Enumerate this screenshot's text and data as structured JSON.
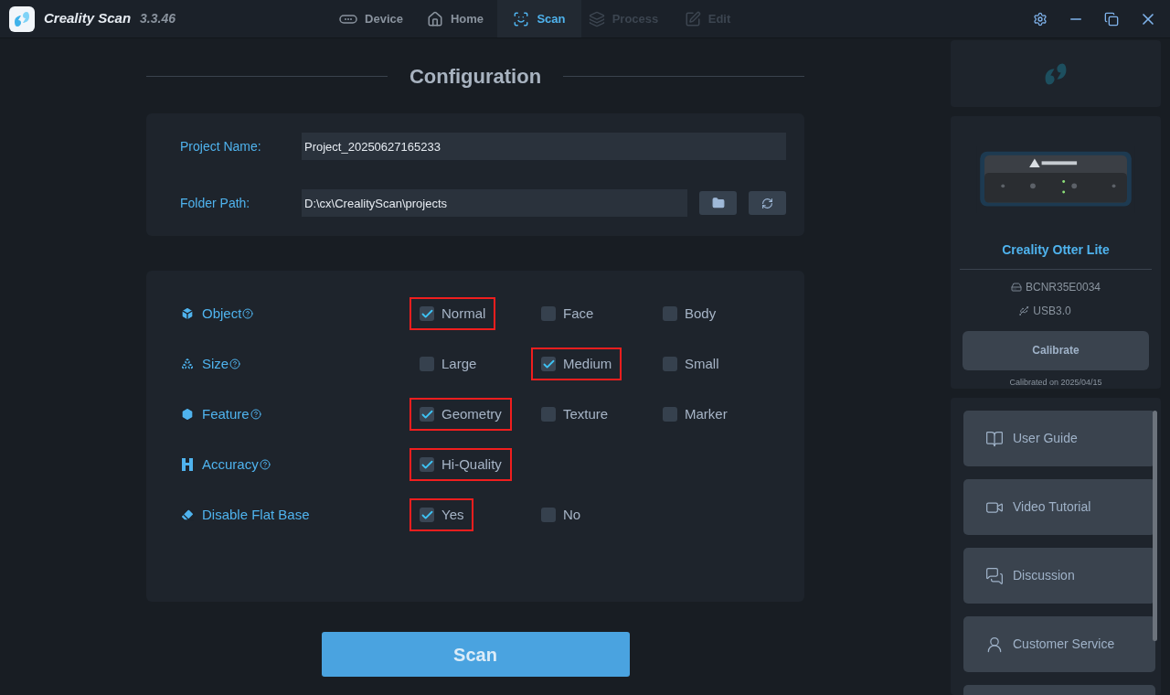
{
  "app": {
    "name": "Creality Scan",
    "version": "3.3.46"
  },
  "tabs": [
    {
      "label": "Device",
      "selected": false,
      "disabled": false
    },
    {
      "label": "Home",
      "selected": false,
      "disabled": false
    },
    {
      "label": "Scan",
      "selected": true,
      "disabled": false
    },
    {
      "label": "Process",
      "selected": false,
      "disabled": true
    },
    {
      "label": "Edit",
      "selected": false,
      "disabled": true
    }
  ],
  "heading": "Configuration",
  "project": {
    "name_label": "Project Name:",
    "name_value": "Project_20250627165233",
    "folder_label": "Folder Path:",
    "folder_value": "D:\\cx\\CrealityScan\\projects"
  },
  "settings": [
    {
      "label": "Object",
      "help": true,
      "options": [
        {
          "label": "Normal",
          "checked": true,
          "highlighted": true
        },
        {
          "label": "Face",
          "checked": false,
          "highlighted": false
        },
        {
          "label": "Body",
          "checked": false,
          "highlighted": false
        }
      ]
    },
    {
      "label": "Size",
      "help": true,
      "options": [
        {
          "label": "Large",
          "checked": false,
          "highlighted": false
        },
        {
          "label": "Medium",
          "checked": true,
          "highlighted": true
        },
        {
          "label": "Small",
          "checked": false,
          "highlighted": false
        }
      ]
    },
    {
      "label": "Feature",
      "help": true,
      "options": [
        {
          "label": "Geometry",
          "checked": true,
          "highlighted": true
        },
        {
          "label": "Texture",
          "checked": false,
          "highlighted": false
        },
        {
          "label": "Marker",
          "checked": false,
          "highlighted": false
        }
      ]
    },
    {
      "label": "Accuracy",
      "help": true,
      "options": [
        {
          "label": "Hi-Quality",
          "checked": true,
          "highlighted": true
        }
      ]
    },
    {
      "label": "Disable Flat Base",
      "help": false,
      "options": [
        {
          "label": "Yes",
          "checked": true,
          "highlighted": true
        },
        {
          "label": "No",
          "checked": false,
          "highlighted": false
        }
      ]
    }
  ],
  "scan_button": "Scan",
  "device": {
    "name": "Creality Otter Lite",
    "serial": "BCNR35E0034",
    "connection": "USB3.0",
    "calibrate": "Calibrate",
    "calibrated_on": "Calibrated on 2025/04/15"
  },
  "links": [
    {
      "label": "User Guide"
    },
    {
      "label": "Video Tutorial"
    },
    {
      "label": "Discussion"
    },
    {
      "label": "Customer Service"
    }
  ]
}
